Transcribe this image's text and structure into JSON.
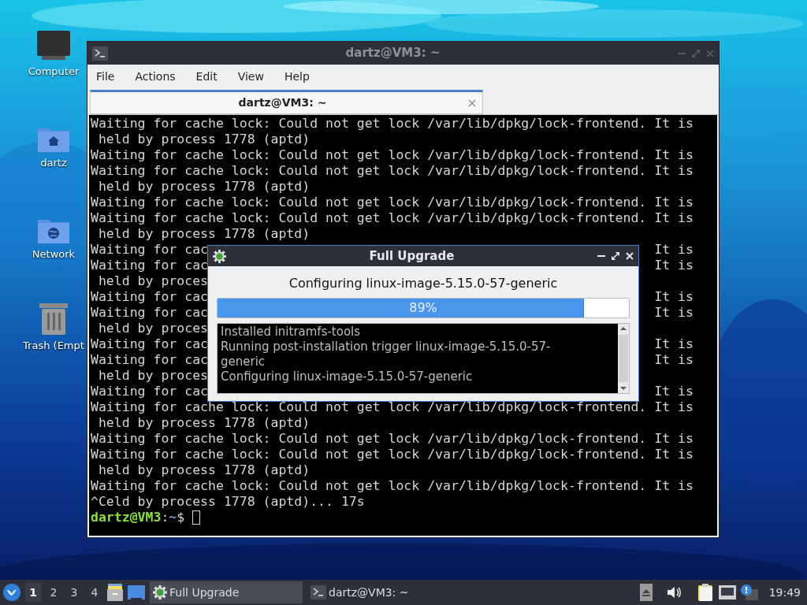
{
  "desktop": {
    "icons": [
      {
        "kind": "computer",
        "label": "Computer"
      },
      {
        "kind": "home",
        "label": "dartz"
      },
      {
        "kind": "network",
        "label": "Network"
      },
      {
        "kind": "trash",
        "label": "Trash (Empt"
      }
    ]
  },
  "terminal": {
    "title": "dartz@VM3: ~",
    "menu": [
      "File",
      "Actions",
      "Edit",
      "View",
      "Help"
    ],
    "tabs": [
      {
        "label": "dartz@VM3: ~",
        "selected": true
      }
    ],
    "lines": [
      {
        "text": "Waiting for cache lock: Could not get lock /var/lib/dpkg/lock-frontend. It is"
      },
      {
        "text": " held by process 1778 (aptd)"
      },
      {
        "text": "Waiting for cache lock: Could not get lock /var/lib/dpkg/lock-frontend. It is"
      },
      {
        "text": "Waiting for cache lock: Could not get lock /var/lib/dpkg/lock-frontend. It is"
      },
      {
        "text": " held by process 1778 (aptd)"
      },
      {
        "text": "Waiting for cache lock: Could not get lock /var/lib/dpkg/lock-frontend. It is"
      },
      {
        "text": "Waiting for cache lock: Could not get lock /var/lib/dpkg/lock-frontend. It is"
      },
      {
        "text": " held by process 1778 (aptd)"
      },
      {
        "text": "Waiting for cac",
        "tail": "It is"
      },
      {
        "text": "Waiting for cac",
        "tail": "It is"
      },
      {
        "text": " held by proces"
      },
      {
        "text": "Waiting for cac",
        "tail": "It is"
      },
      {
        "text": "Waiting for cac",
        "tail": "It is"
      },
      {
        "text": " held by proces"
      },
      {
        "text": "Waiting for cac",
        "tail": "It is"
      },
      {
        "text": "Waiting for cac",
        "tail": "It is"
      },
      {
        "text": " held by proces"
      },
      {
        "text": "Waiting for cac",
        "tail": "It is"
      },
      {
        "text": "Waiting for cache lock: Could not get lock /var/lib/dpkg/lock-frontend. It is"
      },
      {
        "text": " held by process 1778 (aptd)"
      },
      {
        "text": "Waiting for cache lock: Could not get lock /var/lib/dpkg/lock-frontend. It is"
      },
      {
        "text": "Waiting for cache lock: Could not get lock /var/lib/dpkg/lock-frontend. It is"
      },
      {
        "text": " held by process 1778 (aptd)"
      },
      {
        "text": "Waiting for cache lock: Could not get lock /var/lib/dpkg/lock-frontend. It is"
      },
      {
        "text": "^Celd by process 1778 (aptd)... 17s"
      }
    ],
    "prompt": {
      "user": "dartz@VM3",
      "separator": ":",
      "path": "~",
      "symbol": "$"
    }
  },
  "dialog": {
    "title": "Full Upgrade",
    "status": "Configuring linux-image-5.15.0-57-generic",
    "progress": {
      "level": 0.89,
      "label": "89%"
    },
    "log": [
      "Installed initramfs-tools",
      "Running post-installation trigger linux-image-5.15.0-57-",
      "generic",
      "Configuring linux-image-5.15.0-57-generic"
    ]
  },
  "taskbar": {
    "workspaces": [
      {
        "label": "1",
        "selected": true
      },
      {
        "label": "2",
        "selected": false
      },
      {
        "label": "3",
        "selected": false
      },
      {
        "label": "4",
        "selected": false
      }
    ],
    "tasks": [
      {
        "kind": "upgrade",
        "label": "Full Upgrade",
        "selected": true
      },
      {
        "kind": "terminal",
        "label": "dartz@VM3: ~",
        "selected": false
      }
    ],
    "clock": "19:49"
  }
}
